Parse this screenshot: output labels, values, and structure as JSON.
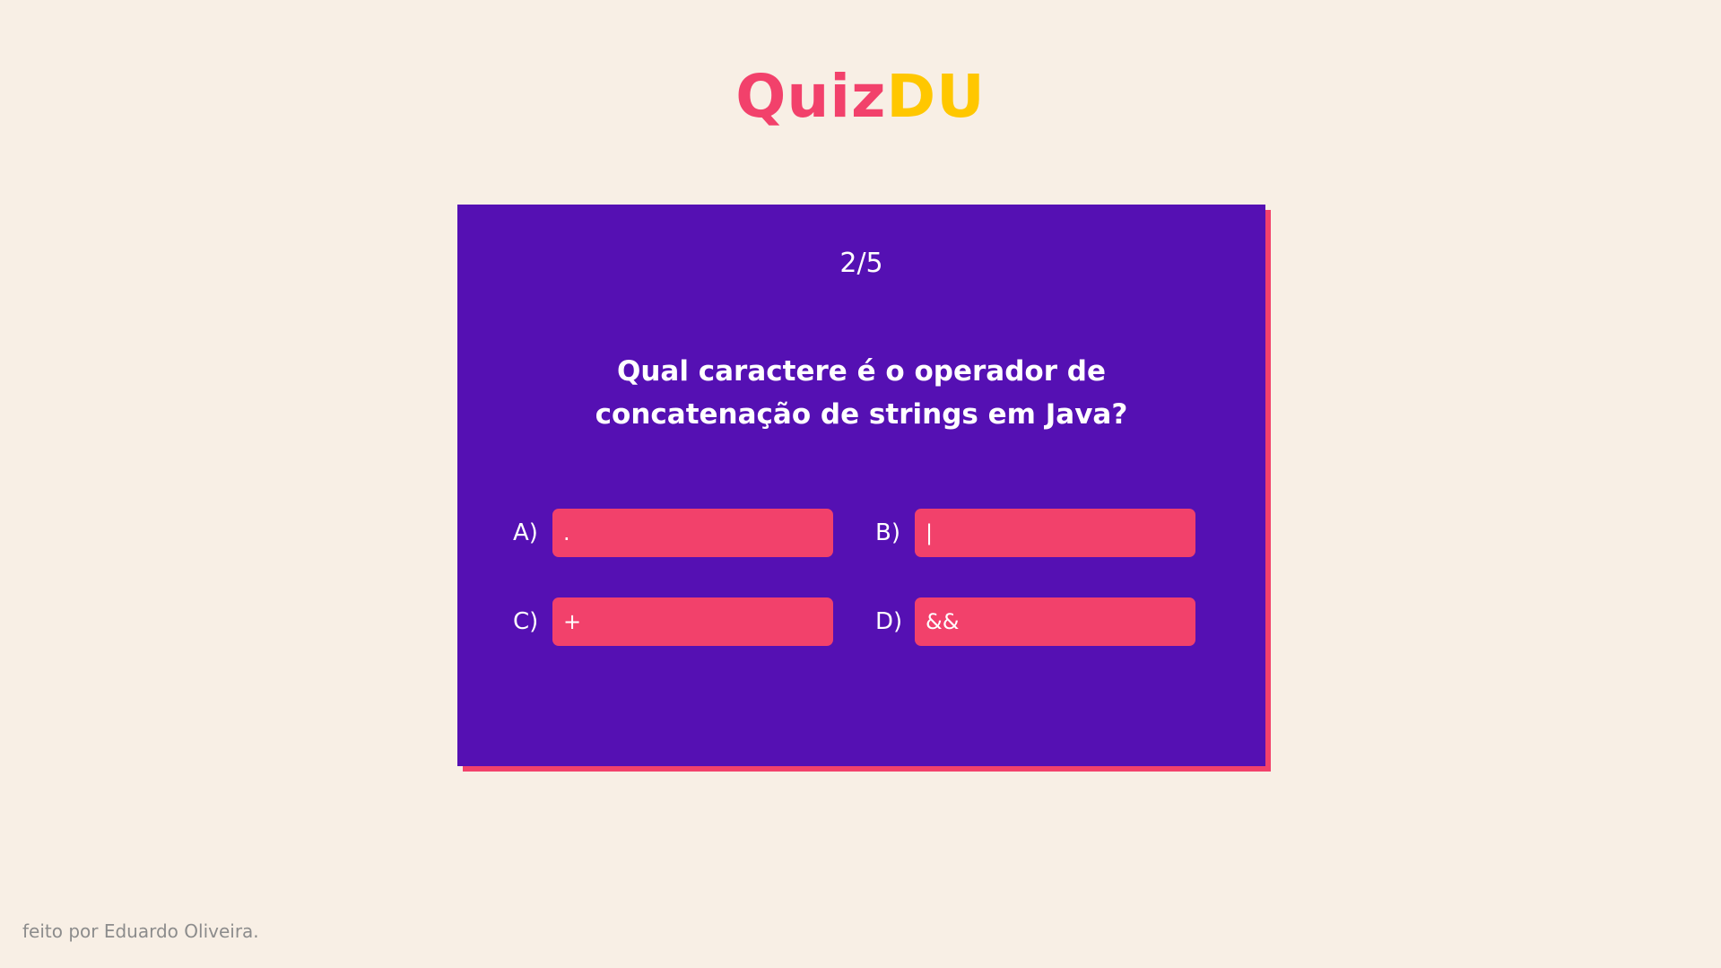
{
  "logo": {
    "part1": "Quiz",
    "part2": "DU"
  },
  "quiz": {
    "counter": "2/5",
    "question": "Qual caractere é o operador de concatenação de strings em Java?",
    "options": [
      {
        "letter": "A)",
        "text": "."
      },
      {
        "letter": "B)",
        "text": "|"
      },
      {
        "letter": "C)",
        "text": "+"
      },
      {
        "letter": "D)",
        "text": "&&"
      }
    ]
  },
  "footer": {
    "credit": "feito por Eduardo Oliveira."
  },
  "colors": {
    "background": "#f8efe5",
    "card": "#5510b3",
    "accent_pink": "#f2416b",
    "accent_yellow": "#ffc700"
  }
}
